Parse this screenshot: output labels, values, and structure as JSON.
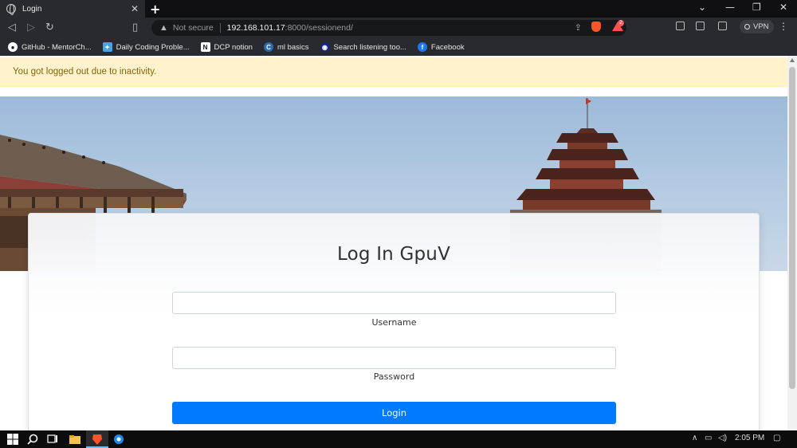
{
  "browser": {
    "tab_title": "Login",
    "tab_close": "✕",
    "new_tab": "+",
    "window_controls": [
      "⌄",
      "—",
      "❐",
      "✕"
    ],
    "address": {
      "security_label": "Not secure",
      "host": "192.168.101.17",
      "path": ":8000/sessionend/"
    },
    "brave_badge": "2",
    "vpn_label": "VPN",
    "menu": "⋮",
    "bookmarks": [
      {
        "label": "GitHub - MentorCh...",
        "icon": "github-icon",
        "color": "#ffffff"
      },
      {
        "label": "Daily Coding Proble...",
        "icon": "dcp-icon",
        "color": "#4aa3df"
      },
      {
        "label": "DCP notion",
        "icon": "notion-icon",
        "color": "#ffffff"
      },
      {
        "label": "ml basics",
        "icon": "c-icon",
        "color": "#2b6cb0"
      },
      {
        "label": "Search listening too...",
        "icon": "listening-icon",
        "color": "#1a237e"
      },
      {
        "label": "Facebook",
        "icon": "facebook-icon",
        "color": "#1877f2"
      }
    ]
  },
  "page": {
    "alert": "You got logged out due to inactivity.",
    "title": "Log In GpuV",
    "username_label": "Username",
    "username_value": "",
    "password_label": "Password",
    "password_value": "",
    "login_button": "Login"
  },
  "taskbar": {
    "time": "2:05 PM"
  },
  "colors": {
    "accent": "#007bff",
    "alert_bg": "#fff3cd",
    "alert_text": "#856404"
  }
}
